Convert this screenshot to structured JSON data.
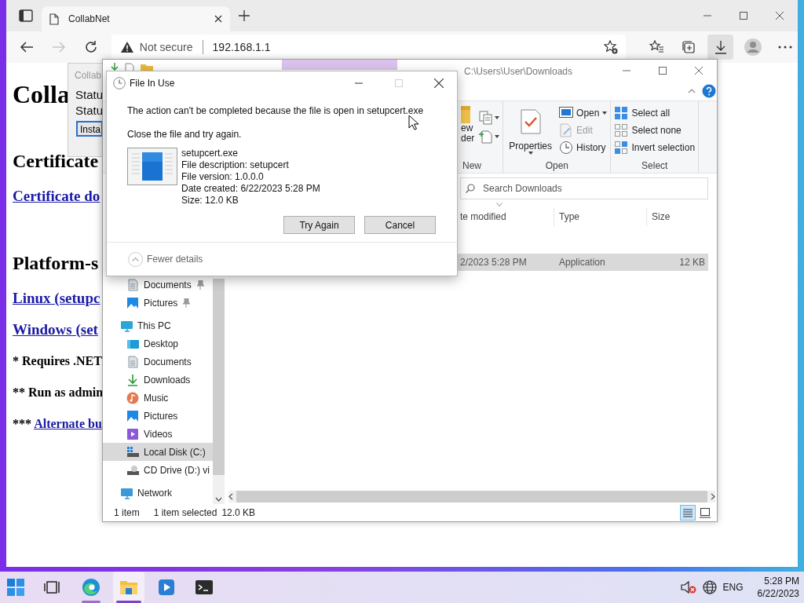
{
  "browser": {
    "tabs": [
      {
        "title": "CollabNet",
        "selected": true
      }
    ],
    "nav_buttons": [
      {
        "kind": "back",
        "disabled": false
      },
      {
        "kind": "forward",
        "disabled": true
      },
      {
        "kind": "refresh",
        "disabled": false
      }
    ],
    "address": {
      "security_label": "Not secure",
      "url": "192.168.1.1"
    },
    "toolbar_buttons": [
      {
        "kind": "favorites",
        "active": false
      },
      {
        "kind": "collections",
        "active": false
      },
      {
        "kind": "downloads",
        "active": true
      },
      {
        "kind": "profile",
        "active": false
      },
      {
        "kind": "more",
        "active": false
      }
    ],
    "page": {
      "blocks": [
        {
          "kind": "h1",
          "text": "Colla"
        },
        {
          "kind": "h2",
          "text": "Certificate"
        },
        {
          "kind": "link",
          "text": "Certificate do"
        },
        {
          "kind": "h2",
          "text": "Platform-s"
        },
        {
          "kind": "link",
          "text": "Linux (setupc"
        },
        {
          "kind": "link",
          "text": "Windows (set"
        },
        {
          "kind": "note",
          "text": "* Requires .NET"
        },
        {
          "kind": "note",
          "text": "** Run as admin"
        },
        {
          "kind": "note-link",
          "text": "***",
          "link": "Alternate bu"
        }
      ]
    }
  },
  "background_window": {
    "title": "Collab",
    "lines": [
      "Statu",
      "Statu"
    ],
    "button": "Insta"
  },
  "explorer": {
    "title": "C:\\Users\\User\\Downloads",
    "ribbon": {
      "new_group": {
        "label": "New",
        "new_folder_lines": [
          "ew",
          "der"
        ]
      },
      "open_group": {
        "label": "Open",
        "properties": "Properties",
        "items": [
          {
            "kind": "open",
            "label": "Open",
            "disabled": false,
            "dropdown": true
          },
          {
            "kind": "edit",
            "label": "Edit",
            "disabled": true,
            "dropdown": false
          },
          {
            "kind": "history",
            "label": "History",
            "disabled": false,
            "dropdown": false
          }
        ]
      },
      "select_group": {
        "label": "Select",
        "items": [
          {
            "kind": "select-all",
            "label": "Select all"
          },
          {
            "kind": "select-none",
            "label": "Select none"
          },
          {
            "kind": "invert",
            "label": "Invert selection"
          }
        ]
      }
    },
    "search_placeholder": "Search Downloads",
    "columns": [
      {
        "label": "te modified",
        "sorted": true
      },
      {
        "label": "Type",
        "sorted": false
      },
      {
        "label": "Size",
        "sorted": false
      }
    ],
    "files": [
      {
        "date": "2/2023 5:28 PM",
        "type": "Application",
        "size": "12 KB",
        "selected": true
      }
    ],
    "nav": [
      {
        "children": [
          {
            "label": "Documents",
            "kind": "documents",
            "pinned": true,
            "selected": false
          },
          {
            "label": "Pictures",
            "kind": "pictures",
            "pinned": true,
            "selected": false
          }
        ]
      },
      {
        "label": "This PC",
        "kind": "pc",
        "pinned": false,
        "selected": false,
        "children": [
          {
            "label": "Desktop",
            "kind": "desktop",
            "pinned": false,
            "selected": false
          },
          {
            "label": "Documents",
            "kind": "documents",
            "pinned": false,
            "selected": false
          },
          {
            "label": "Downloads",
            "kind": "downloads",
            "pinned": false,
            "selected": false
          },
          {
            "label": "Music",
            "kind": "music",
            "pinned": false,
            "selected": false
          },
          {
            "label": "Pictures",
            "kind": "pictures",
            "pinned": false,
            "selected": false
          },
          {
            "label": "Videos",
            "kind": "videos",
            "pinned": false,
            "selected": false
          },
          {
            "label": "Local Disk (C:)",
            "kind": "disk",
            "pinned": false,
            "selected": true
          },
          {
            "label": "CD Drive (D:) vi",
            "kind": "cd",
            "pinned": false,
            "selected": false
          }
        ]
      },
      {
        "label": "Network",
        "kind": "network",
        "pinned": false,
        "selected": false
      }
    ],
    "status": {
      "count": "1 item",
      "selection": "1 item selected",
      "size": "12.0 KB"
    },
    "views": [
      {
        "kind": "details",
        "selected": true
      },
      {
        "kind": "tiles",
        "selected": false
      }
    ]
  },
  "dialog": {
    "title": "File In Use",
    "maximize_disabled": true,
    "message": "The action can't be completed because the file is open in setupcert.exe",
    "instruction": "Close the file and try again.",
    "file": {
      "name": "setupcert.exe",
      "details": [
        "File description: setupcert",
        "File version: 1.0.0.0",
        "Date created: 6/22/2023 5:28 PM",
        "Size: 12.0 KB"
      ]
    },
    "buttons": [
      {
        "label": "Try Again"
      },
      {
        "label": "Cancel"
      }
    ],
    "details_toggle": "Fewer details"
  },
  "taskbar": {
    "apps": [
      {
        "kind": "start",
        "running": false,
        "active": false
      },
      {
        "kind": "task-view",
        "running": false,
        "active": false
      },
      {
        "kind": "edge",
        "running": true,
        "active": false
      },
      {
        "kind": "explorer",
        "running": true,
        "active": true
      },
      {
        "kind": "media",
        "running": false,
        "active": false
      },
      {
        "kind": "terminal",
        "running": false,
        "active": false
      }
    ],
    "tray": {
      "volume_muted": true,
      "language": "ENG",
      "time": "5:28 PM",
      "date": "6/22/2023"
    }
  }
}
